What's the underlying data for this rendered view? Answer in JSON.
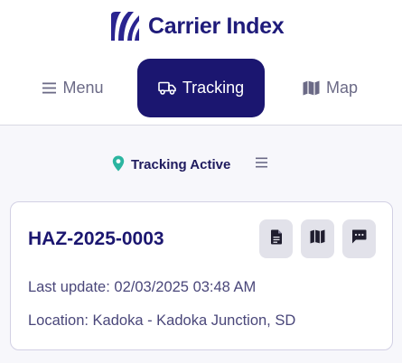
{
  "brand": {
    "name": "Carrier Index",
    "logo_icon": "carrier-index-logo",
    "color": "#1f1b7a"
  },
  "nav": {
    "items": [
      {
        "label": "Menu",
        "icon": "hamburger-icon",
        "active": false
      },
      {
        "label": "Tracking",
        "icon": "truck-icon",
        "active": true
      },
      {
        "label": "Map",
        "icon": "map-icon",
        "active": false
      }
    ],
    "active_color": "#1b1670"
  },
  "status": {
    "label": "Tracking Active",
    "icon": "location-pin-icon",
    "pin_color": "#2bb5a0"
  },
  "shipment": {
    "id": "HAZ-2025-0003",
    "last_update": "Last update: 02/03/2025 03:48 AM",
    "location": "Location: Kadoka - Kadoka Junction, SD",
    "actions": [
      "document-icon",
      "map-icon",
      "message-icon"
    ]
  }
}
